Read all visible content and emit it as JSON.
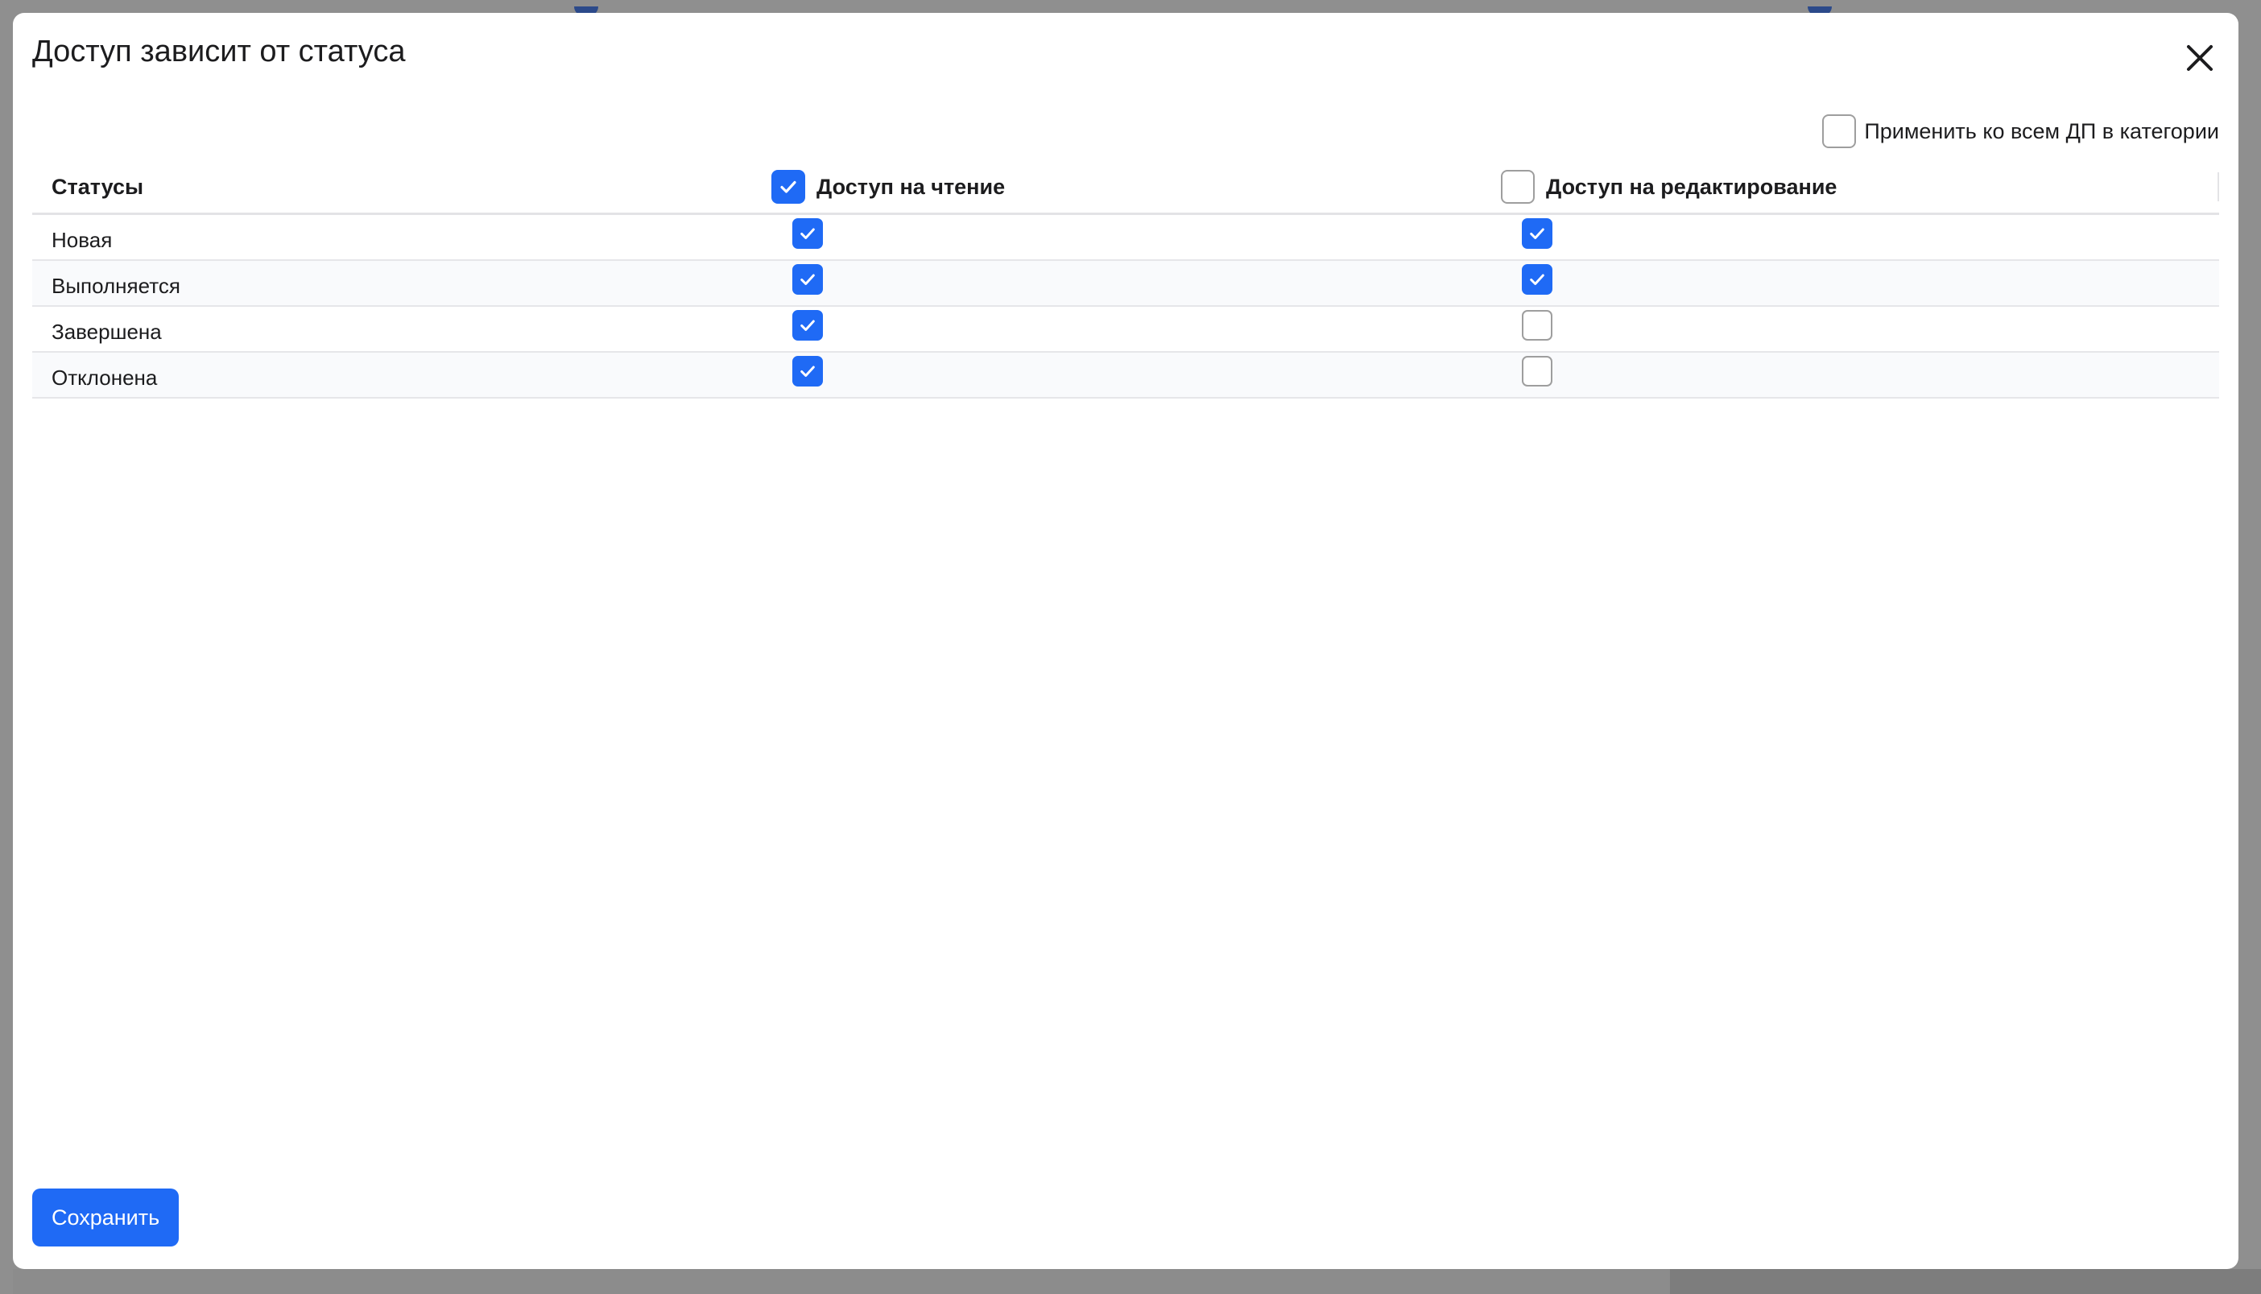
{
  "modal": {
    "title": "Доступ зависит от статуса",
    "close_icon": "close-icon",
    "apply_all": {
      "label": "Применить ко всем ДП в категории",
      "checked": false
    },
    "save_label": "Сохранить"
  },
  "table": {
    "columns": {
      "status": "Статусы",
      "read": {
        "label": "Доступ на чтение",
        "checked": true
      },
      "edit": {
        "label": "Доступ на редактирование",
        "checked": false
      }
    },
    "rows": [
      {
        "status": "Новая",
        "read": true,
        "edit": true
      },
      {
        "status": "Выполняется",
        "read": true,
        "edit": true
      },
      {
        "status": "Завершена",
        "read": true,
        "edit": false
      },
      {
        "status": "Отклонена",
        "read": true,
        "edit": false
      }
    ]
  },
  "colors": {
    "accent": "#1f6af5",
    "backdrop": "#8f8f8f",
    "checkbox_border": "#9e9e9e"
  }
}
